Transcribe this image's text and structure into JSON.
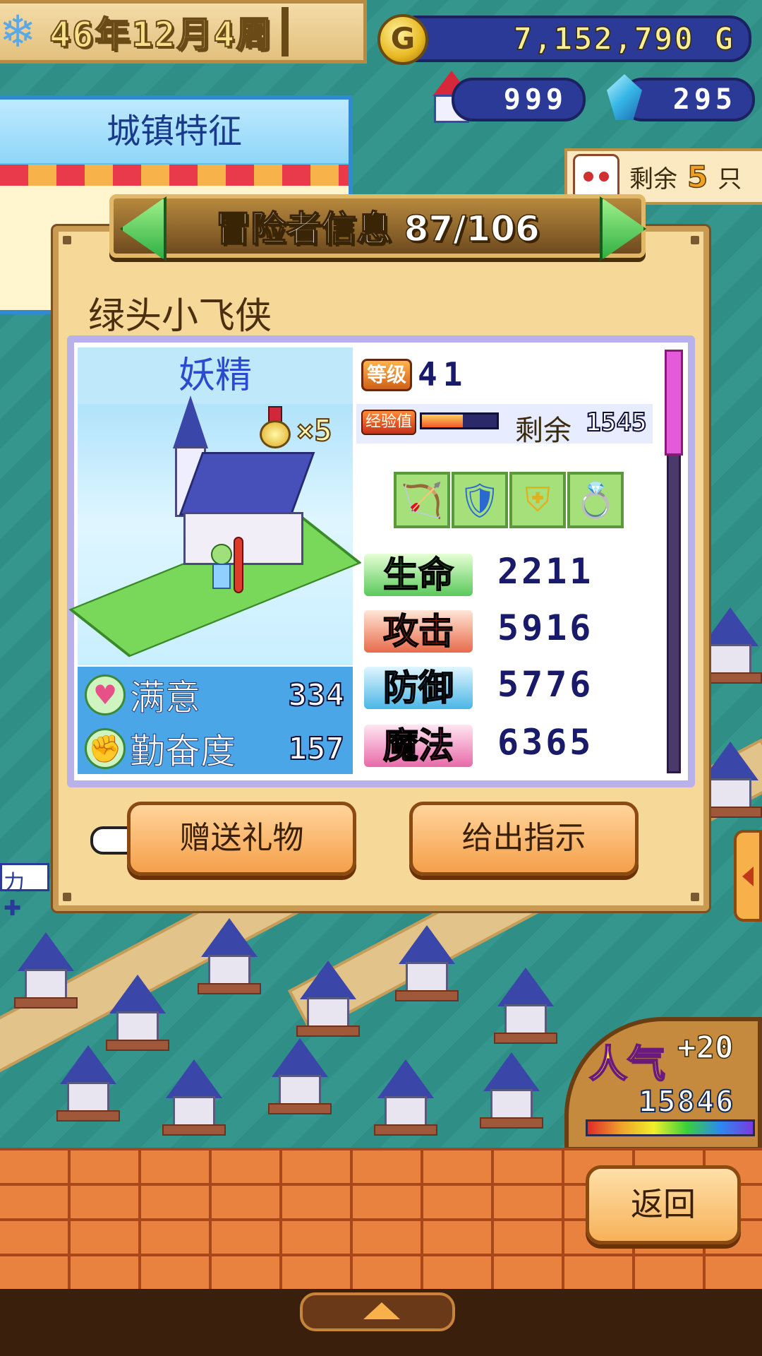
{
  "hud": {
    "date": "46年12月4周",
    "gold": "7,152,790 G",
    "gold_coin_letter": "G",
    "houses": "999",
    "crystals": "295",
    "remaining_label": "剩余",
    "remaining_count": "5",
    "remaining_unit": "只"
  },
  "town_feature": {
    "title": "城镇特征"
  },
  "dialog": {
    "title": "冒险者信息 87/106",
    "adventurer_name": "绿头小飞侠",
    "job": "妖精",
    "medal_count": "×5",
    "level_label": "等级",
    "level": "41",
    "exp_label": "经验值",
    "exp_progress": 0.55,
    "exp_remaining_label": "剩余",
    "exp_remaining": "1545",
    "equipment": [
      {
        "icon": "bow-icon"
      },
      {
        "icon": "armor-icon"
      },
      {
        "icon": "shield-icon"
      },
      {
        "icon": "accessory-icon"
      }
    ],
    "satisfaction_label": "满意",
    "satisfaction": "334",
    "diligence_label": "勤奋度",
    "diligence": "157",
    "stats": [
      {
        "label": "生命",
        "value": "2211",
        "color": "#5ac95a"
      },
      {
        "label": "攻击",
        "value": "5916",
        "color": "#e86a4a"
      },
      {
        "label": "防御",
        "value": "5776",
        "color": "#4ab6e6"
      },
      {
        "label": "魔法",
        "value": "6365",
        "color": "#e86aa8"
      }
    ],
    "buttons": {
      "gift": "赠送礼物",
      "order": "给出指示"
    }
  },
  "side": {
    "power_chip": "力 ✚"
  },
  "popularity": {
    "label": "人气",
    "delta": "+20",
    "value": "15846",
    "gauge_level": 1.0
  },
  "footer": {
    "back": "返回"
  },
  "colors": {
    "panel_border": "#b9b2ea",
    "dialog_bg": "#f6d898",
    "banner": "#8a5e26",
    "scrollbar_thumb": "#e45ad8"
  }
}
